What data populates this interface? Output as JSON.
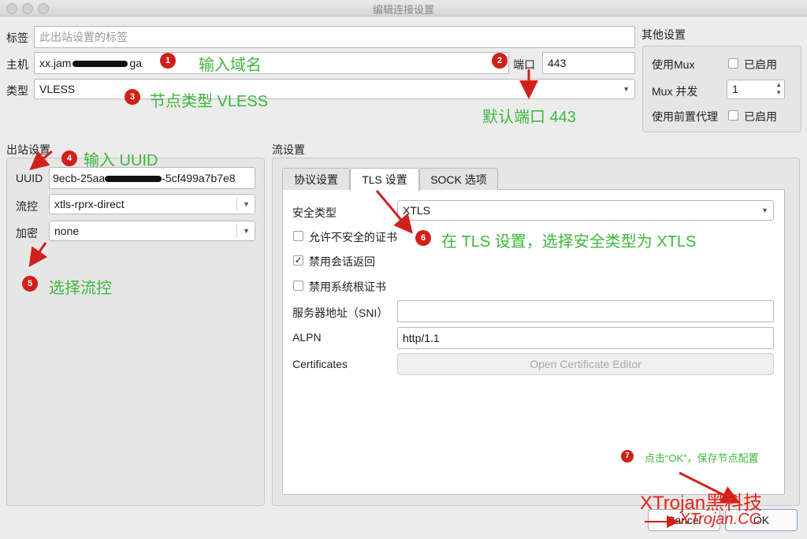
{
  "window": {
    "title": "编辑连接设置"
  },
  "connection": {
    "tag_label": "标签",
    "tag_placeholder": "此出站设置的标签",
    "host_label": "主机",
    "host_prefix": "xx.jam",
    "host_suffix": "ga",
    "port_label": "端口",
    "port_value": "443",
    "type_label": "类型",
    "type_value": "VLESS"
  },
  "other_settings": {
    "title": "其他设置",
    "mux_label": "使用Mux",
    "mux_checkbox": "已启用",
    "mux_concurrency_label": "Mux 并发",
    "mux_concurrency_value": "1",
    "front_proxy_label": "使用前置代理",
    "front_proxy_checkbox": "已启用"
  },
  "outbound": {
    "title": "出站设置",
    "uuid_label": "UUID",
    "uuid_start": "9ecb-25aa",
    "uuid_end": "-5cf499a7b7e8",
    "flow_label": "流控",
    "flow_value": "xtls-rprx-direct",
    "encryption_label": "加密",
    "encryption_value": "none"
  },
  "stream": {
    "title": "流设置",
    "tabs": [
      {
        "label": "协议设置",
        "active": false
      },
      {
        "label": "TLS 设置",
        "active": true
      },
      {
        "label": "SOCK 选项",
        "active": false
      }
    ],
    "security_type_label": "安全类型",
    "security_type_value": "XTLS",
    "allow_insecure_label": "允许不安全的证书",
    "allow_insecure_checked": false,
    "disable_session_resumption_label": "禁用会话返回",
    "disable_session_resumption_checked": true,
    "disable_system_root_label": "禁用系统根证书",
    "disable_system_root_checked": false,
    "sni_label": "服务器地址（SNI）",
    "sni_value": "",
    "alpn_label": "ALPN",
    "alpn_value": "http/1.1",
    "certificates_label": "Certificates",
    "open_cert_editor_label": "Open Certificate Editor"
  },
  "buttons": {
    "cancel": "Cancel",
    "ok": "OK"
  },
  "annotations": {
    "a1": {
      "num": "1",
      "text": "输入域名"
    },
    "a2": {
      "num": "2",
      "text": "默认端口 443"
    },
    "a3": {
      "num": "3",
      "text": "节点类型 VLESS"
    },
    "a4": {
      "num": "4",
      "text": "输入 UUID"
    },
    "a5": {
      "num": "5",
      "text": "选择流控"
    },
    "a6": {
      "num": "6",
      "text": "在 TLS 设置，选择安全类型为 XTLS"
    },
    "a7": {
      "num": "7",
      "text": "点击“OK”，保存节点配置"
    }
  },
  "watermark": {
    "line1": "XTrojan黑科技",
    "line2": "XTrojan.CC"
  },
  "colors": {
    "annotation_green": "#3db83d",
    "badge_red": "#d1201a",
    "watermark_red": "#e0261d"
  }
}
